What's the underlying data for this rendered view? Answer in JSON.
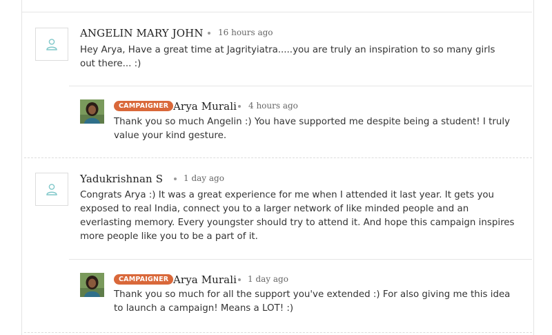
{
  "comments": [
    {
      "author": "ANGELIN MARY JOHN",
      "time": "16 hours ago",
      "text": "Hey Arya, Have a great time at Jagrityiatra.....you are truly an inspiration to so many girls out there... :)",
      "avatar_icon": "user-outline-icon",
      "reply": {
        "badge": "CAMPAIGNER",
        "author": "Arya Murali",
        "time": "4 hours ago",
        "text": "Thank you so much Angelin :) You have supported me despite being a student! I truly value your kind gesture."
      }
    },
    {
      "author": "Yadukrishnan S",
      "time": "1 day ago",
      "text": "Congrats Arya :) It was a great experience for me when I attended it last year. It gets you exposed to real India, connect you to a larger network of like minded people and an everlasting memory. Every youngster should try to attend it. And hope this campaign inspires more people like you to be a part of it.",
      "avatar_icon": "user-outline-icon",
      "reply": {
        "badge": "CAMPAIGNER",
        "author": "Arya Murali",
        "time": "1 day ago",
        "text": "Thank you so much for all the support you've extended :) For also giving me this idea to launch a campaign! Means a LOT! :)"
      }
    }
  ],
  "colors": {
    "badge": "#d9683a",
    "icon": "#7fc7c9",
    "border": "#e3e3e3"
  }
}
